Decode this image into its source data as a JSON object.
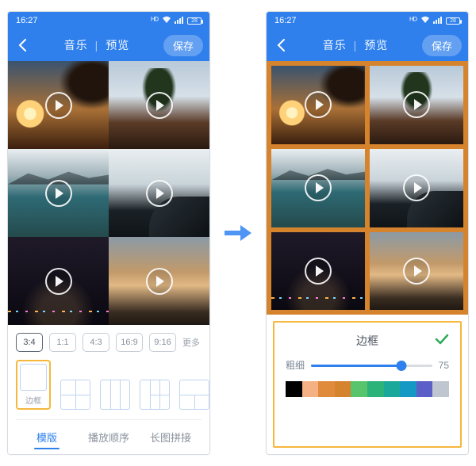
{
  "status": {
    "time": "16:27",
    "battery": "28"
  },
  "header": {
    "music": "音乐",
    "preview": "预览",
    "save": "保存"
  },
  "ratios": {
    "items": [
      "3:4",
      "1:1",
      "4:3",
      "16:9",
      "9:16"
    ],
    "more": "更多",
    "active_index": 0
  },
  "layouts": {
    "border_label": "边框"
  },
  "tabs": {
    "template": "模版",
    "order": "播放顺序",
    "stitch": "长图拼接",
    "active": "template"
  },
  "border_panel": {
    "title": "边框",
    "thickness_label": "粗细",
    "thickness_value": "75",
    "thickness_pct": 75,
    "colors": [
      "#000000",
      "#f4b183",
      "#e08b3c",
      "#d6832e",
      "#58c46b",
      "#2bb37a",
      "#1aa89a",
      "#1498c4",
      "#5b5fc7",
      "#bfc6cf"
    ]
  }
}
